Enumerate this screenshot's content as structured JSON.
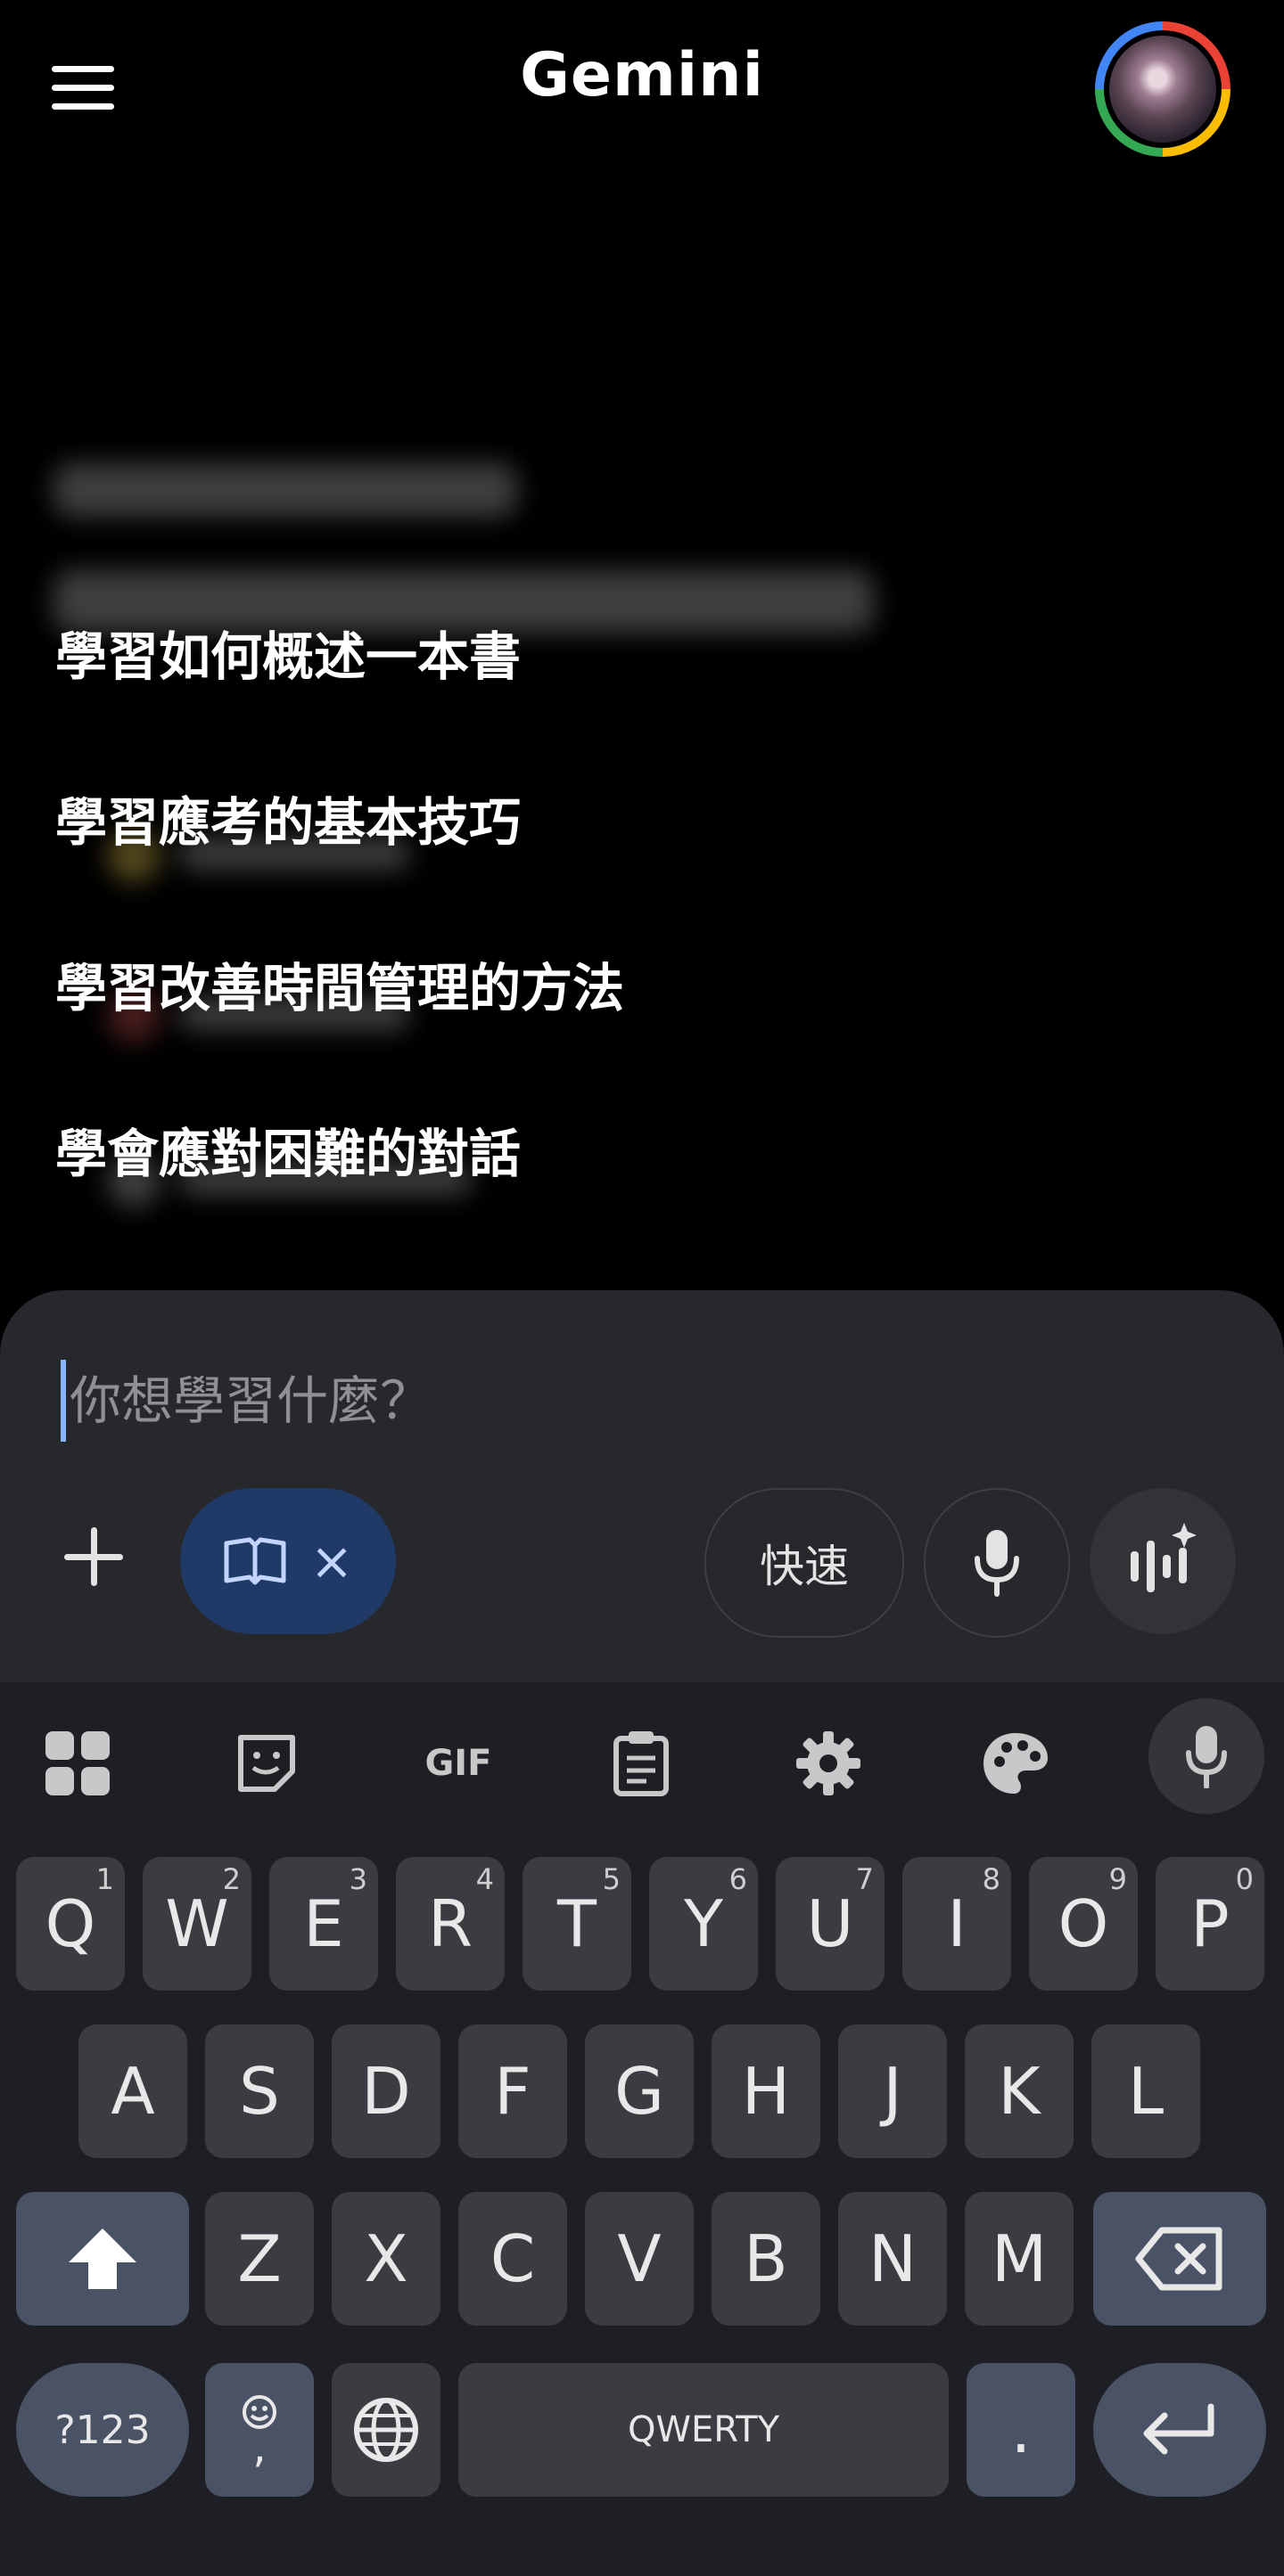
{
  "header": {
    "title": "Gemini"
  },
  "suggestions": [
    "學習如何概述一本書",
    "學習應考的基本技巧",
    "學習改善時間管理的方法",
    "學會應對困難的對話"
  ],
  "composer": {
    "placeholder": "你想學習什麼？",
    "chip_close": "×",
    "fast_label": "快速"
  },
  "keyboard": {
    "row1": [
      {
        "k": "Q",
        "h": "1"
      },
      {
        "k": "W",
        "h": "2"
      },
      {
        "k": "E",
        "h": "3"
      },
      {
        "k": "R",
        "h": "4"
      },
      {
        "k": "T",
        "h": "5"
      },
      {
        "k": "Y",
        "h": "6"
      },
      {
        "k": "U",
        "h": "7"
      },
      {
        "k": "I",
        "h": "8"
      },
      {
        "k": "O",
        "h": "9"
      },
      {
        "k": "P",
        "h": "0"
      }
    ],
    "row2": [
      "A",
      "S",
      "D",
      "F",
      "G",
      "H",
      "J",
      "K",
      "L"
    ],
    "row3": [
      "Z",
      "X",
      "C",
      "V",
      "B",
      "N",
      "M"
    ],
    "toolbar": {
      "gif": "GIF"
    },
    "bottom": {
      "symbols": "?123",
      "comma": ",",
      "space": "QWERTY",
      "period": "."
    }
  }
}
